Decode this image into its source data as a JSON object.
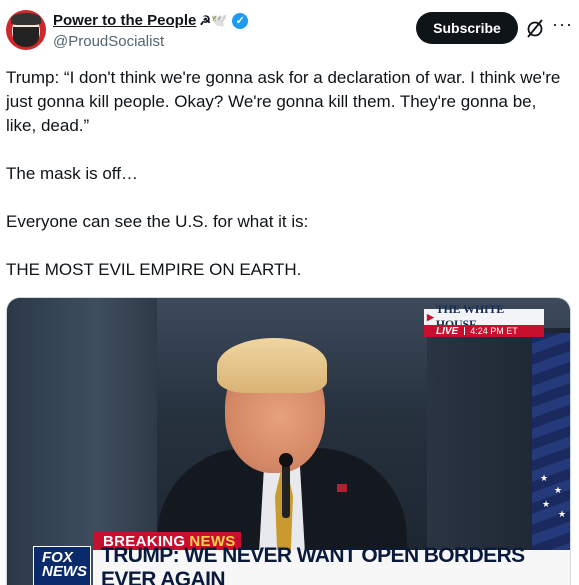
{
  "account": {
    "display_name": "Power to the People",
    "emoji": "☭🕊️",
    "handle": "@ProudSocialist"
  },
  "actions": {
    "subscribe_label": "Subscribe",
    "grok_icon": "grok-slash-icon",
    "more_icon": "more-horizontal-icon",
    "more_glyph": "···"
  },
  "tweet": {
    "paragraphs": [
      "Trump: “I don't think we're gonna ask for a declaration of war. I think we're just gonna kill people. Okay? We're gonna kill them. They're gonna be, like, dead.”",
      "The mask is off…",
      "Everyone can see the U.S. for what it is:",
      "THE MOST EVIL EMPIRE ON EARTH."
    ]
  },
  "media": {
    "badge_title": "THE WHITE HOUSE",
    "badge_live": "LIVE",
    "badge_time": "4:24 PM ET",
    "breaking_label": "BREAKING",
    "breaking_news": "NEWS",
    "chyron": "TRUMP: WE NEVER WANT OPEN BORDERS EVER AGAIN",
    "network_logo_line1": "FOX",
    "network_logo_line2": "NEWS"
  },
  "colors": {
    "subscribe_bg": "#0f1419",
    "verified": "#1d9bf0",
    "fox_red": "#c8102e",
    "handle_gray": "#536471"
  }
}
